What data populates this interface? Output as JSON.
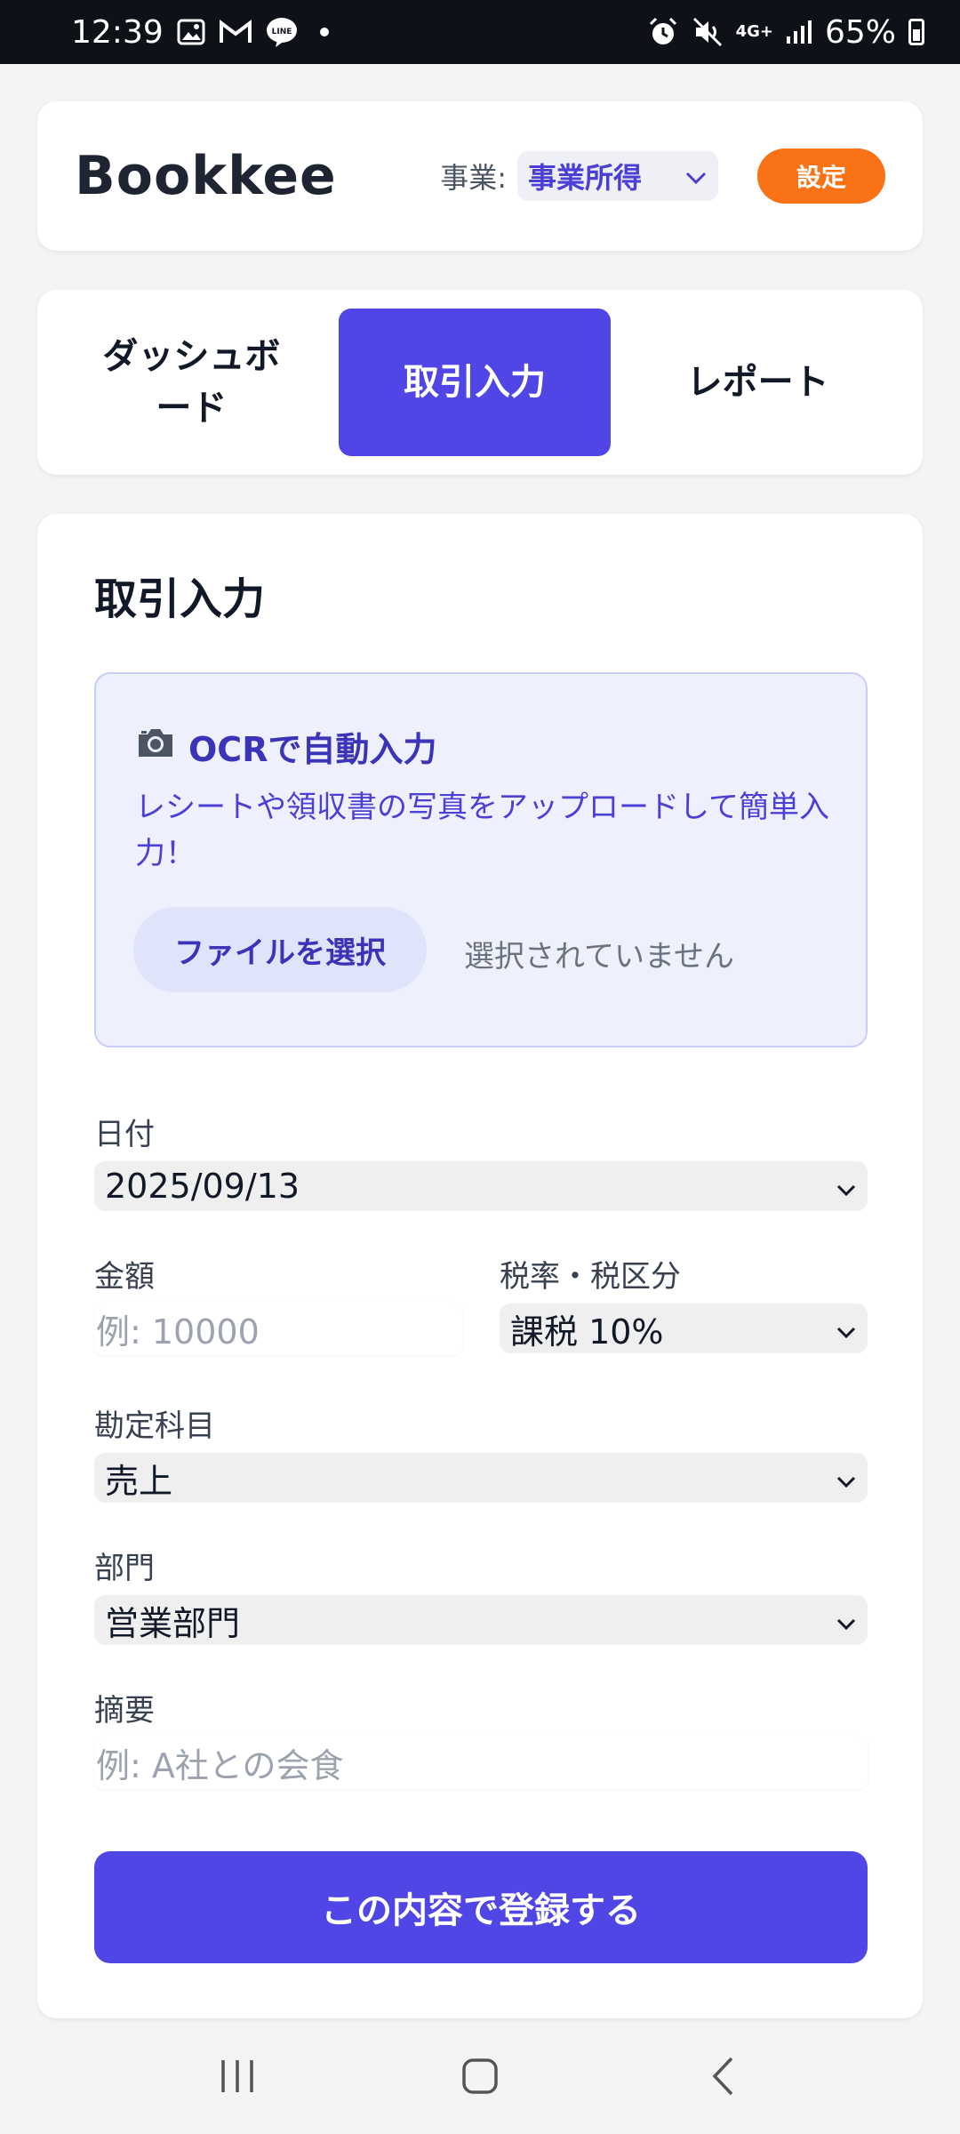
{
  "status_bar": {
    "time": "12:39",
    "network": "4G+",
    "battery": "65%",
    "icons": [
      "gallery-icon",
      "gmail-icon",
      "line-icon",
      "alarm-icon",
      "mute-icon",
      "signal-icon",
      "battery-icon"
    ]
  },
  "header": {
    "app_name": "Bookkee",
    "business_label": "事業:",
    "business_value": "事業所得",
    "settings_label": "設定"
  },
  "tabs": [
    {
      "label": "ダッシュボード",
      "active": false
    },
    {
      "label": "取引入力",
      "active": true
    },
    {
      "label": "レポート",
      "active": false
    }
  ],
  "main": {
    "title": "取引入力",
    "ocr": {
      "title": "OCRで自動入力",
      "description": "レシートや領収書の写真をアップロードして簡単入力！",
      "file_button": "ファイルを選択",
      "file_status": "選択されていません"
    },
    "form": {
      "date_label": "日付",
      "date_value": "2025/09/13",
      "amount_label": "金額",
      "amount_placeholder": "例: 10000",
      "tax_label": "税率・税区分",
      "tax_value": "課税 10%",
      "account_label": "勘定科目",
      "account_value": "売上",
      "department_label": "部門",
      "department_value": "営業部門",
      "memo_label": "摘要",
      "memo_placeholder": "例: A社との会食"
    },
    "submit_label": "この内容で登録する"
  },
  "colors": {
    "primary": "#4f46e5",
    "accent": "#f97316",
    "ocr_bg": "#eef1fd"
  }
}
